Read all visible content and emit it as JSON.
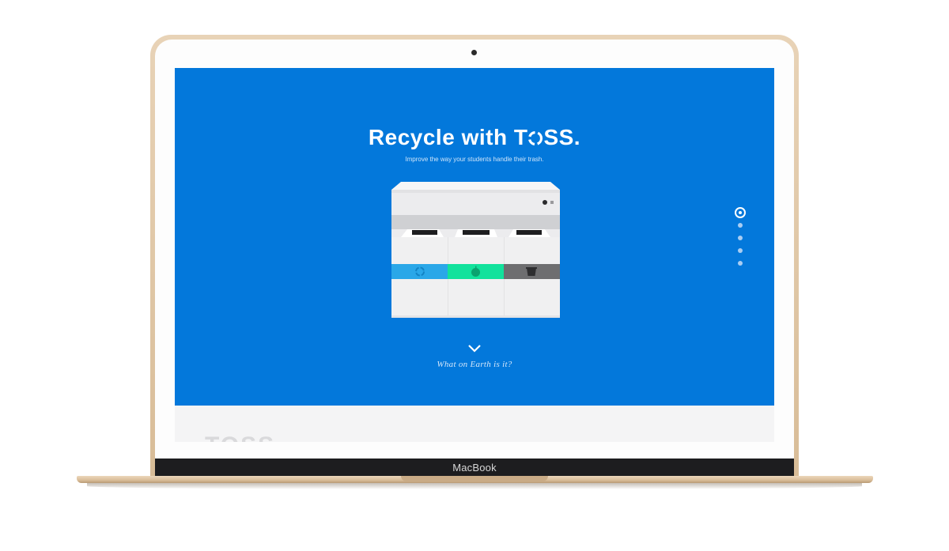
{
  "device": {
    "label": "MacBook"
  },
  "hero": {
    "title_prefix": "Recycle with T",
    "title_suffix": "SS.",
    "subtitle": "Improve the way your students handle their trash.",
    "cta": "What on Earth is it?"
  },
  "machine": {
    "bins": [
      {
        "name": "recycling",
        "color": "#2aa7e8",
        "icon": "recycle-icon"
      },
      {
        "name": "compost",
        "color": "#12e29c",
        "icon": "apple-icon"
      },
      {
        "name": "landfill",
        "color": "#6e6e70",
        "icon": "trash-icon"
      }
    ]
  },
  "pagination": {
    "count": 5,
    "active_index": 0
  },
  "next_section": {
    "logo_partial": "TOSS"
  },
  "colors": {
    "hero_background": "#0378db",
    "recycle": "#2aa7e8",
    "compost": "#12e29c",
    "landfill": "#6e6e70"
  }
}
